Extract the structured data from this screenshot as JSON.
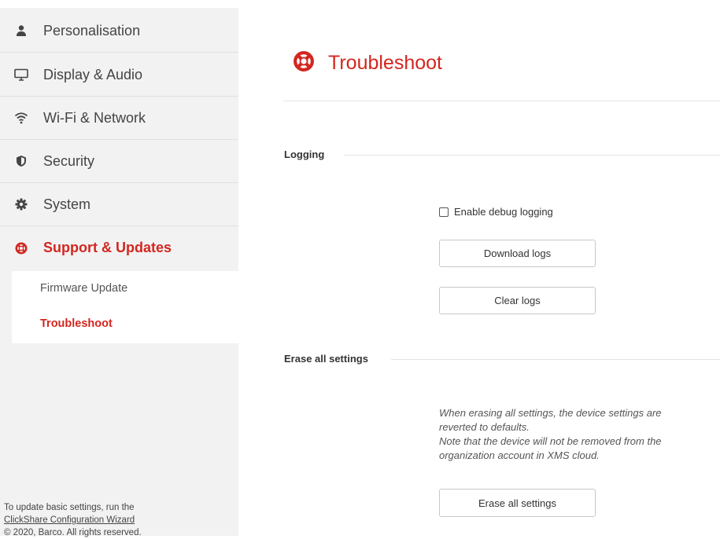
{
  "sidebar": {
    "items": [
      {
        "label": "Personalisation",
        "icon": "person-icon"
      },
      {
        "label": "Display & Audio",
        "icon": "monitor-icon"
      },
      {
        "label": "Wi-Fi & Network",
        "icon": "wifi-icon"
      },
      {
        "label": "Security",
        "icon": "shield-icon"
      },
      {
        "label": "System",
        "icon": "gear-icon"
      },
      {
        "label": "Support & Updates",
        "icon": "lifebuoy-icon",
        "active": true
      }
    ],
    "subitems": [
      {
        "label": "Firmware Update"
      },
      {
        "label": "Troubleshoot",
        "active": true
      }
    ],
    "footer": {
      "line1": "To update basic settings, run the",
      "link": "ClickShare Configuration Wizard",
      "copyright": "© 2020, Barco. All rights reserved."
    }
  },
  "main": {
    "title": "Troubleshoot",
    "title_icon": "lifebuoy-icon",
    "logging": {
      "title": "Logging",
      "debug_label": "Enable debug logging",
      "debug_checked": false,
      "download_button": "Download logs",
      "clear_button": "Clear logs"
    },
    "erase": {
      "title": "Erase all settings",
      "desc_line1": "When erasing all settings, the device settings are",
      "desc_line2": "reverted to defaults.",
      "desc_line3": "Note that the device will not be removed from the",
      "desc_line4": "organization account in XMS cloud.",
      "button": "Erase all settings"
    }
  },
  "colors": {
    "accent": "#d3261f",
    "sidebar_bg": "#f2f2f2",
    "text": "#333333"
  }
}
